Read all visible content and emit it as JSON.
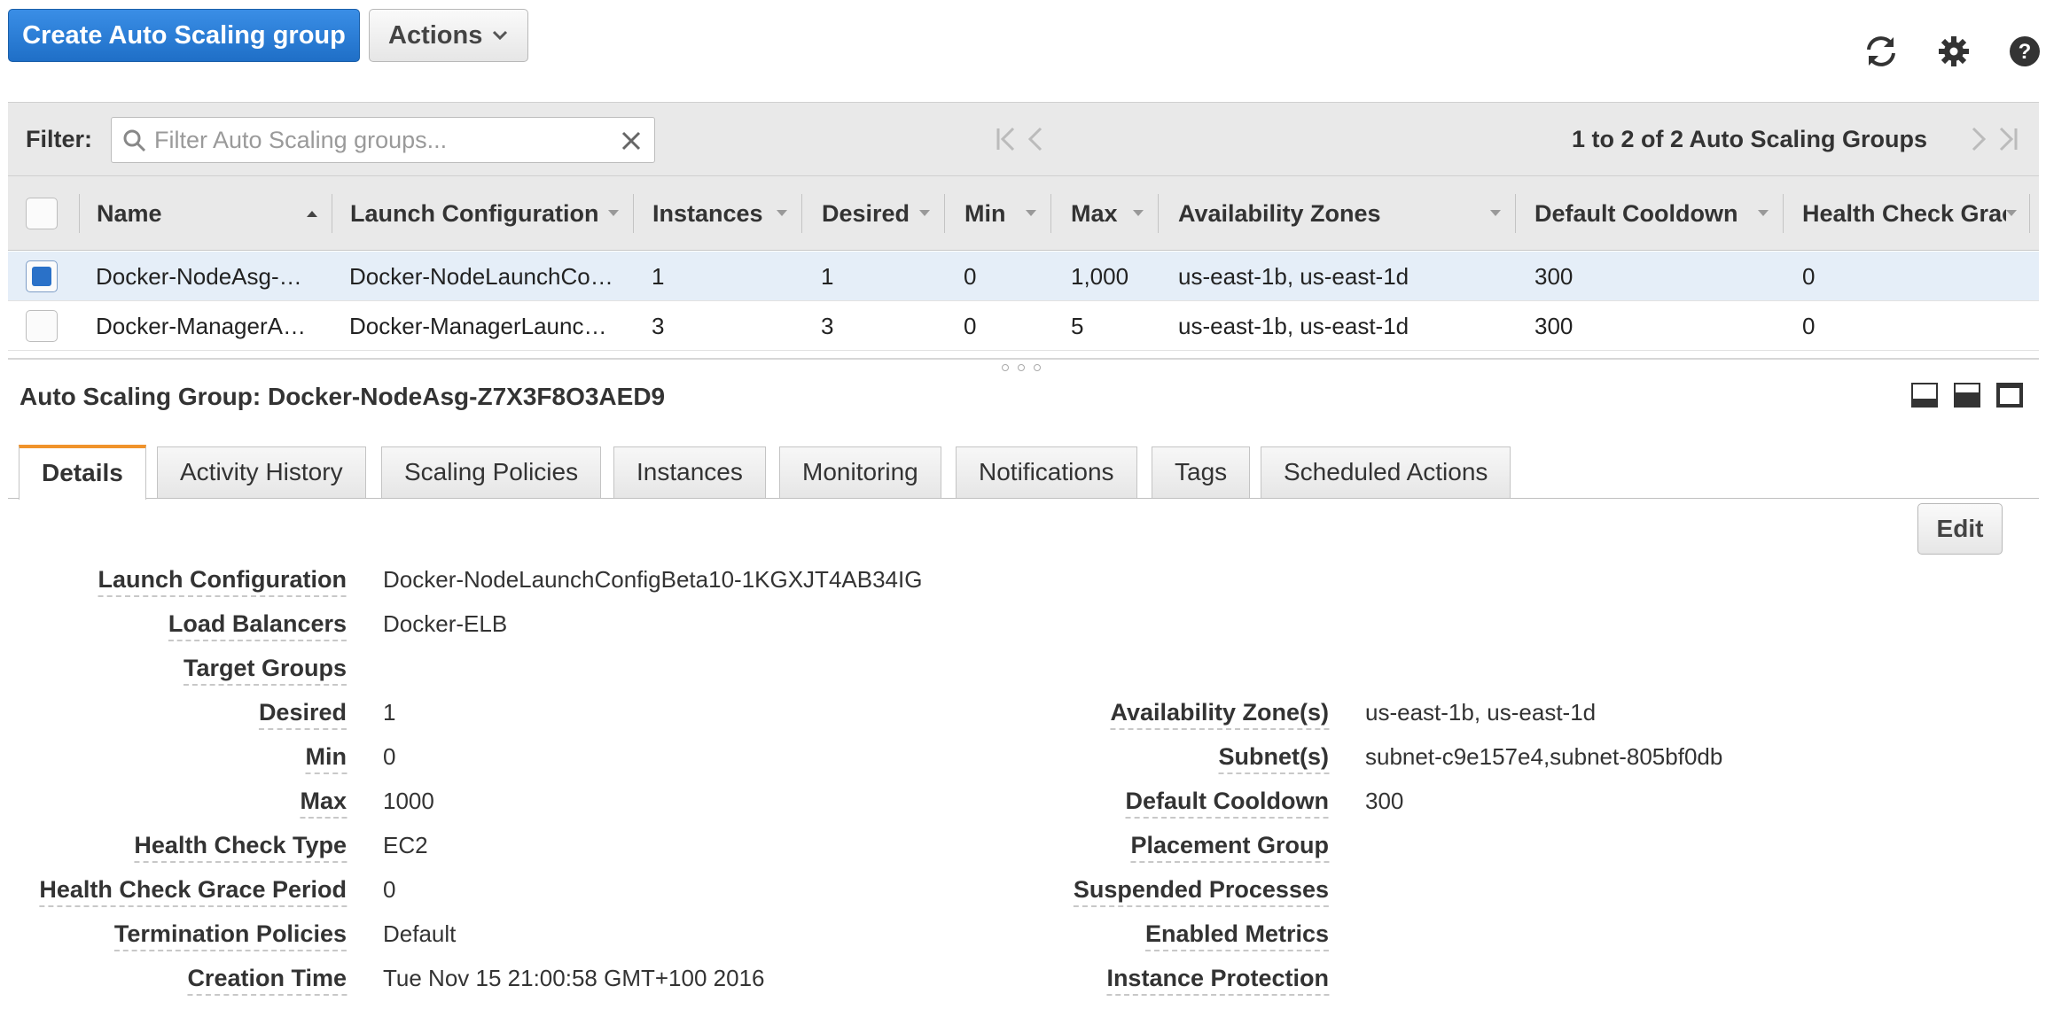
{
  "toolbar": {
    "create_label": "Create Auto Scaling group",
    "actions_label": "Actions",
    "icons": [
      "refresh-icon",
      "gear-icon",
      "help-icon"
    ]
  },
  "filter": {
    "label": "Filter:",
    "placeholder": "Filter Auto Scaling groups...",
    "pager_text": "1 to 2 of 2 Auto Scaling Groups"
  },
  "table": {
    "columns": [
      "Name",
      "Launch Configuration",
      "Instances",
      "Desired",
      "Min",
      "Max",
      "Availability Zones",
      "Default Cooldown",
      "Health Check Grac"
    ],
    "rows": [
      {
        "selected": true,
        "cells": [
          "Docker-NodeAsg-…",
          "Docker-NodeLaunchCo…",
          "1",
          "1",
          "0",
          "1,000",
          "us-east-1b, us-east-1d",
          "300",
          "0"
        ]
      },
      {
        "selected": false,
        "cells": [
          "Docker-ManagerA…",
          "Docker-ManagerLaunc…",
          "3",
          "3",
          "0",
          "5",
          "us-east-1b, us-east-1d",
          "300",
          "0"
        ]
      }
    ]
  },
  "details": {
    "title": "Auto Scaling Group: Docker-NodeAsg-Z7X3F8O3AED9",
    "tabs": [
      "Details",
      "Activity History",
      "Scaling Policies",
      "Instances",
      "Monitoring",
      "Notifications",
      "Tags",
      "Scheduled Actions"
    ],
    "edit_label": "Edit",
    "left": [
      {
        "label": "Launch Configuration",
        "value": "Docker-NodeLaunchConfigBeta10-1KGXJT4AB34IG"
      },
      {
        "label": "Load Balancers",
        "value": "Docker-ELB"
      },
      {
        "label": "Target Groups",
        "value": ""
      },
      {
        "label": "Desired",
        "value": "1"
      },
      {
        "label": "Min",
        "value": "0"
      },
      {
        "label": "Max",
        "value": "1000"
      },
      {
        "label": "Health Check Type",
        "value": "EC2"
      },
      {
        "label": "Health Check Grace Period",
        "value": "0"
      },
      {
        "label": "Termination Policies",
        "value": "Default"
      },
      {
        "label": "Creation Time",
        "value": "Tue Nov 15 21:00:58 GMT+100 2016"
      }
    ],
    "right": [
      {
        "label": "Availability Zone(s)",
        "value": "us-east-1b, us-east-1d"
      },
      {
        "label": "Subnet(s)",
        "value": "subnet-c9e157e4,subnet-805bf0db"
      },
      {
        "label": "Default Cooldown",
        "value": "300"
      },
      {
        "label": "Placement Group",
        "value": ""
      },
      {
        "label": "Suspended Processes",
        "value": ""
      },
      {
        "label": "Enabled Metrics",
        "value": ""
      },
      {
        "label": "Instance Protection",
        "value": ""
      }
    ]
  }
}
